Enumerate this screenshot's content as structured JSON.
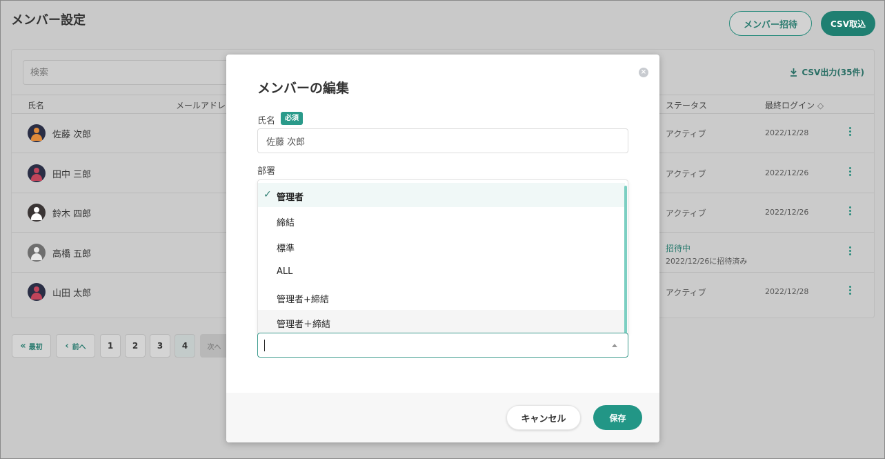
{
  "header": {
    "title": "メンバー設定",
    "invite_label": "メンバー招待",
    "csv_import_label": "CSV取込"
  },
  "toolbar": {
    "search_placeholder": "検索",
    "csv_export_label": "CSV出力(35件)"
  },
  "table": {
    "columns": [
      "氏名",
      "メールアドレ",
      "ステータス",
      "最終ログイン"
    ],
    "rows": [
      {
        "name": "佐藤 次郎",
        "status": "アクティブ",
        "last_login": "2022/12/28",
        "avatar_color": "#e08a3a"
      },
      {
        "name": "田中 三郎",
        "status": "アクティブ",
        "last_login": "2022/12/26",
        "avatar_color": "#c0445a"
      },
      {
        "name": "鈴木 四郎",
        "status": "アクティブ",
        "last_login": "2022/12/26",
        "avatar_color": "#ffffff"
      },
      {
        "name": "高橋 五郎",
        "status": "招待中",
        "status_sub": "2022/12/26に招待済み",
        "last_login": "",
        "avatar_color": "#ffffff"
      },
      {
        "name": "山田 太郎",
        "status": "アクティブ",
        "last_login": "2022/12/28",
        "avatar_color": "#c0445a"
      }
    ]
  },
  "pagination": {
    "first_label": "最初",
    "prev_label": "前へ",
    "pages": [
      "1",
      "2",
      "3",
      "4"
    ],
    "current_page": "4",
    "next_label": "次へ"
  },
  "modal": {
    "title": "メンバーの編集",
    "name_label": "氏名",
    "required_badge": "必須",
    "name_value": "佐藤 次郎",
    "department_label": "部署",
    "options": [
      "管理者",
      "締結",
      "標準",
      "ALL",
      "管理者+締結",
      "管理者＋締結"
    ],
    "selected_option": "管理者",
    "cancel_label": "キャンセル",
    "save_label": "保存"
  },
  "colors": {
    "accent": "#229686",
    "overlay": "#c9c9c9"
  }
}
